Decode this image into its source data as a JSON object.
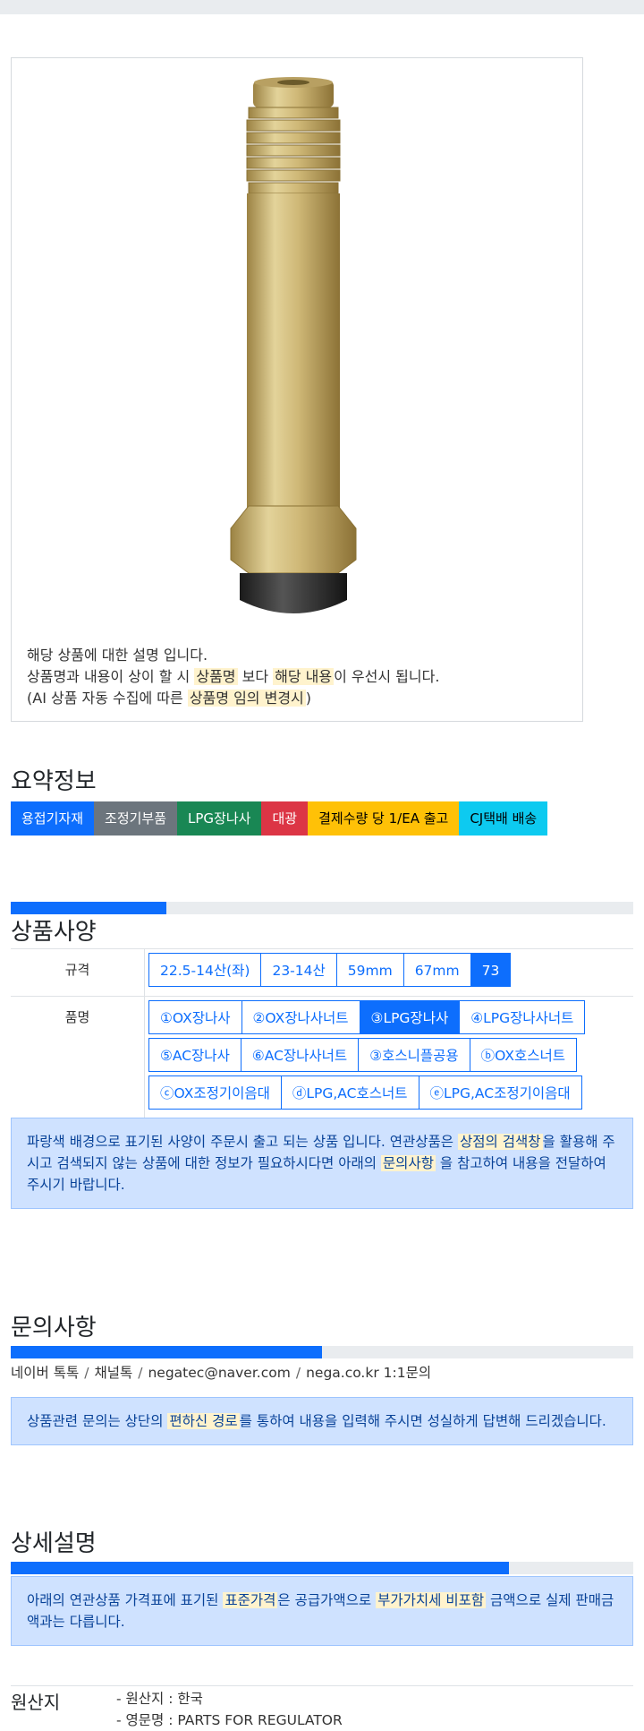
{
  "notice": {
    "line1": "해당 상품에 대한 설명 입니다.",
    "line2_pre": "상품명과 내용이 상이 할 시 ",
    "line2_hl1": "상품명",
    "line2_mid": " 보다 ",
    "line2_hl2": "해당 내용",
    "line2_post": "이 우선시 됩니다.",
    "line3_pre": "(AI 상품 자동 수집에 따른 ",
    "line3_hl": "상품명 임의 변경시",
    "line3_post": ")"
  },
  "summary": {
    "title": "요약정보",
    "badges": [
      {
        "label": "용접기자재",
        "color": "#0d6efd",
        "text_color": "#ffffff"
      },
      {
        "label": "조정기부품",
        "color": "#6c757d",
        "text_color": "#ffffff"
      },
      {
        "label": "LPG장나사",
        "color": "#198754",
        "text_color": "#ffffff"
      },
      {
        "label": "대광",
        "color": "#dc3545",
        "text_color": "#ffffff"
      },
      {
        "label": "결제수량 당 1/EA 출고",
        "color": "#ffc107",
        "text_color": "#000000"
      },
      {
        "label": "CJ택배 배송",
        "color": "#0dcaf0",
        "text_color": "#000000"
      }
    ]
  },
  "spec": {
    "title": "상품사양",
    "progress": 0.25,
    "rows": [
      {
        "label": "규격",
        "options": [
          "22.5-14산(좌)",
          "23-14산",
          "59mm",
          "67mm",
          "73"
        ],
        "selected": 4
      },
      {
        "label": "품명",
        "options": [
          "①OX장나사",
          "②OX장나사너트",
          "③LPG장나사",
          "④LPG장나사너트",
          "⑤AC장나사",
          "⑥AC장나사너트",
          "③호스니플공용",
          "ⓑOX호스너트",
          "ⓒOX조정기이음대",
          "ⓓLPG,AC호스너트",
          "ⓔLPG,AC조정기이음대"
        ],
        "selected": 2
      }
    ],
    "alert_pre": "파랑색 배경으로 표기된 사양이 주문시 출고 되는 상품 입니다. 연관상품은 ",
    "alert_hl1": "상점의 검색창",
    "alert_mid": "을 활용해 주시고 검색되지 않는 상품에 대한 정보가 필요하시다면 아래의 ",
    "alert_hl2": "문의사항",
    "alert_post": " 을 참고하여 내용을 전달하여 주시기 바랍니다."
  },
  "inquiry": {
    "title": "문의사항",
    "progress": 0.5,
    "contacts": [
      "네이버 톡톡",
      "채널톡",
      "negatec@naver.com",
      "nega.co.kr 1:1문의"
    ],
    "separator": "/",
    "alert_pre": "상품관련 문의는 상단의 ",
    "alert_hl": "편하신 경로",
    "alert_post": "를 통하여 내용을 입력해 주시면 성실하게 답변해 드리겠습니다."
  },
  "detail": {
    "title": "상세설명",
    "progress": 0.8,
    "alert_pre": "아래의 연관상품 가격표에 표기된 ",
    "alert_hl1": "표준가격",
    "alert_mid": "은 공급가액으로 ",
    "alert_hl2": "부가가치세 비포함",
    "alert_post": " 금액으로 실제 판매금액과는 다릅니다."
  },
  "origin": {
    "label": "원산지",
    "items": [
      "- 원산지 : 한국",
      "- 영문명 : PARTS FOR REGULATOR"
    ]
  }
}
